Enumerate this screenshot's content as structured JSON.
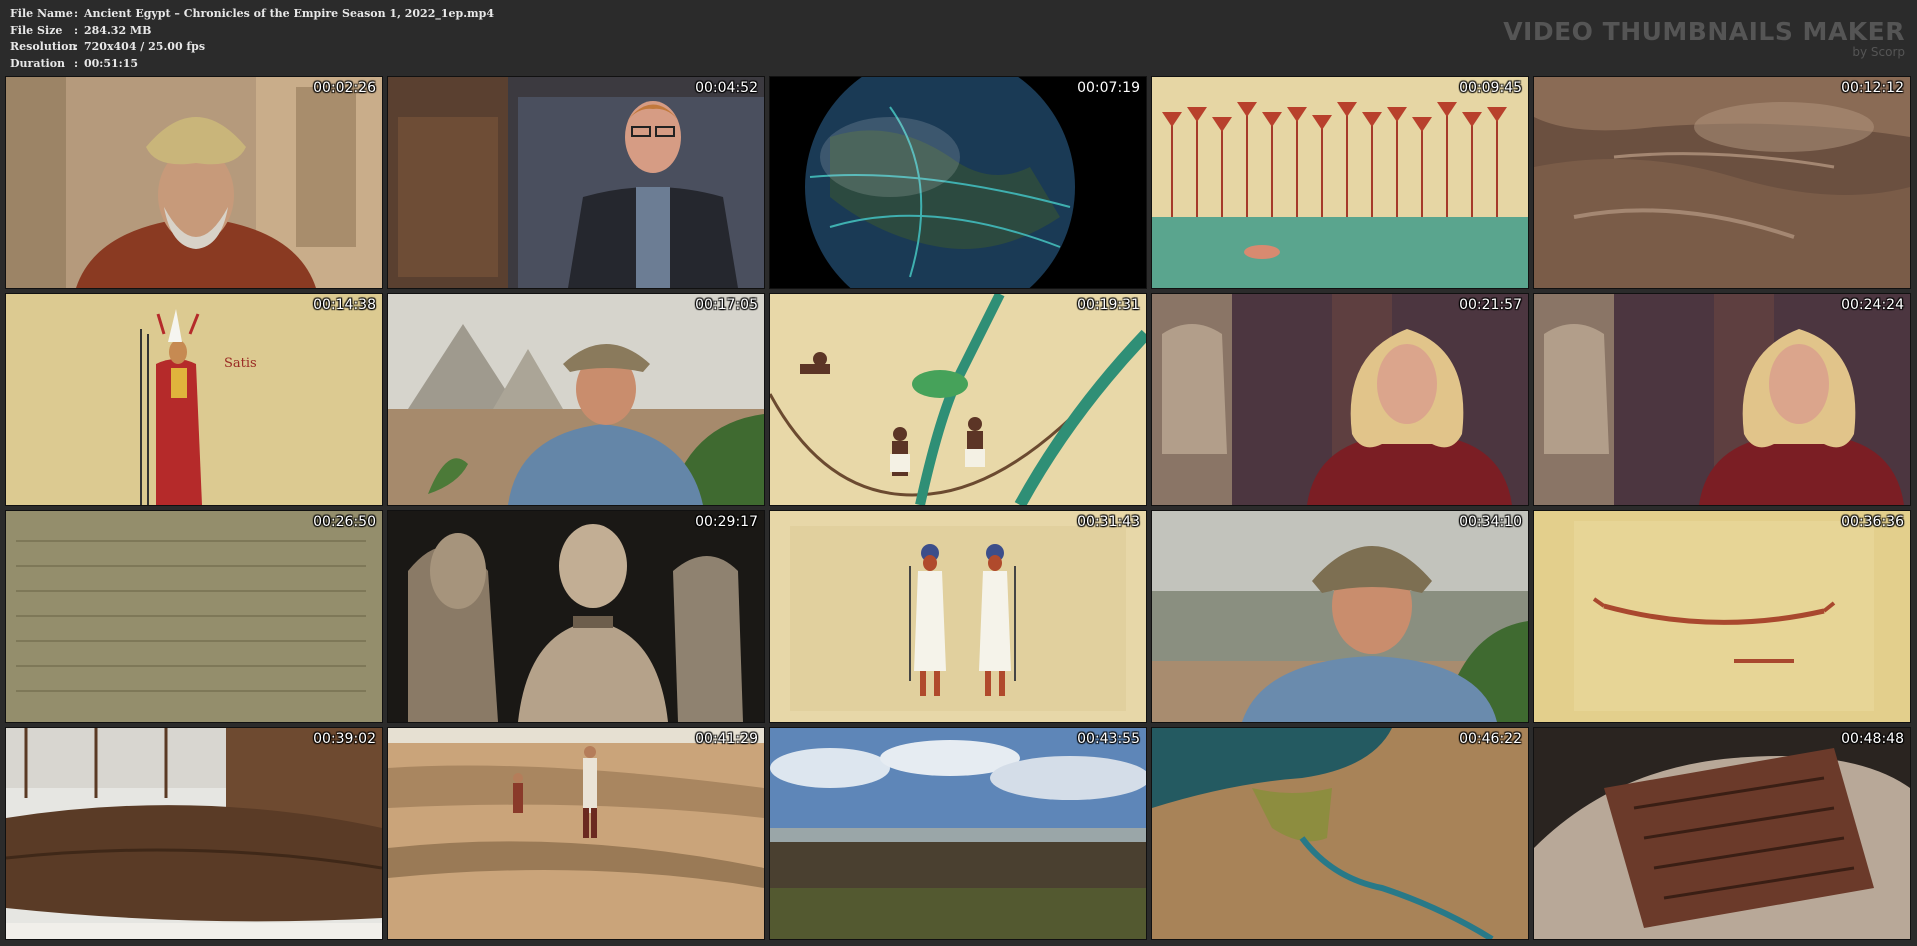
{
  "file_info": [
    {
      "key": "File Name",
      "value": "Ancient Egypt – Chronicles of the Empire Season 1, 2022_1ep.mp4"
    },
    {
      "key": "File Size",
      "value": "284.32 MB"
    },
    {
      "key": "Resolution",
      "value": "720x404 / 25.00 fps"
    },
    {
      "key": "Duration",
      "value": "00:51:15"
    }
  ],
  "brand": {
    "title": "VIDEO THUMBNAILS MAKER",
    "subtitle": "by Scorp"
  },
  "thumbnails": [
    {
      "time": "00:02:26",
      "scene": "man-turban"
    },
    {
      "time": "00:04:52",
      "scene": "man-glasses"
    },
    {
      "time": "00:07:19",
      "scene": "globe"
    },
    {
      "time": "00:09:45",
      "scene": "papyrus-reeds"
    },
    {
      "time": "00:12:12",
      "scene": "mud"
    },
    {
      "time": "00:14:38",
      "scene": "goddess-satis",
      "caption": "Satis"
    },
    {
      "time": "00:17:05",
      "scene": "man-hat-pyramids"
    },
    {
      "time": "00:19:31",
      "scene": "farmers-nile"
    },
    {
      "time": "00:21:57",
      "scene": "woman-blonde"
    },
    {
      "time": "00:24:24",
      "scene": "woman-blonde"
    },
    {
      "time": "00:26:50",
      "scene": "stone-inscription"
    },
    {
      "time": "00:29:17",
      "scene": "statues"
    },
    {
      "time": "00:31:43",
      "scene": "two-figures"
    },
    {
      "time": "00:34:10",
      "scene": "man-hat-closeup"
    },
    {
      "time": "00:36:36",
      "scene": "papyrus-boat"
    },
    {
      "time": "00:39:02",
      "scene": "wooden-boat"
    },
    {
      "time": "00:41:29",
      "scene": "excavation"
    },
    {
      "time": "00:43:55",
      "scene": "landscape"
    },
    {
      "time": "00:46:22",
      "scene": "nile-map"
    },
    {
      "time": "00:48:48",
      "scene": "clay-tablet"
    }
  ]
}
